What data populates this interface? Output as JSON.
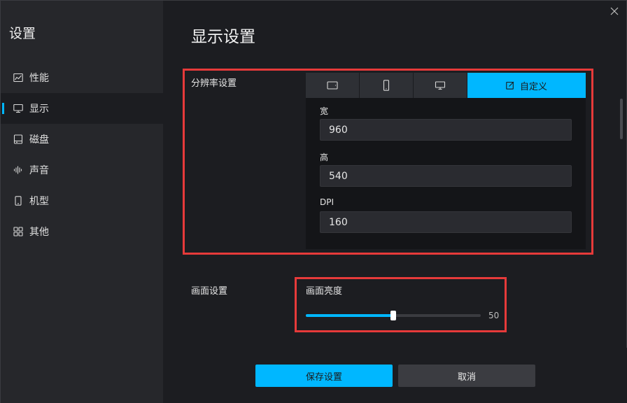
{
  "sidebar": {
    "title": "设置",
    "items": [
      {
        "label": "性能",
        "icon": "chart-line-icon"
      },
      {
        "label": "显示",
        "icon": "monitor-icon"
      },
      {
        "label": "磁盘",
        "icon": "disk-icon"
      },
      {
        "label": "声音",
        "icon": "sound-wave-icon"
      },
      {
        "label": "机型",
        "icon": "phone-icon"
      },
      {
        "label": "其他",
        "icon": "grid-icon"
      }
    ],
    "active_index": 1
  },
  "main": {
    "title": "显示设置",
    "resolution": {
      "section_label": "分辨率设置",
      "tabs": [
        {
          "icon": "tablet-landscape-icon"
        },
        {
          "icon": "phone-portrait-icon"
        },
        {
          "icon": "monitor-icon"
        },
        {
          "icon": "edit-icon",
          "label": "自定义"
        }
      ],
      "active_tab": 3,
      "width_label": "宽",
      "width_value": "960",
      "height_label": "高",
      "height_value": "540",
      "dpi_label": "DPI",
      "dpi_value": "160"
    },
    "screen": {
      "section_label": "画面设置",
      "brightness_label": "画面亮度",
      "brightness_value": "50",
      "brightness_max": 100
    }
  },
  "footer": {
    "save_label": "保存设置",
    "cancel_label": "取消"
  },
  "colors": {
    "accent": "#00b7ff",
    "highlight_border": "#e63a3a",
    "background": "#1c1d21",
    "sidebar": "#26272b"
  }
}
